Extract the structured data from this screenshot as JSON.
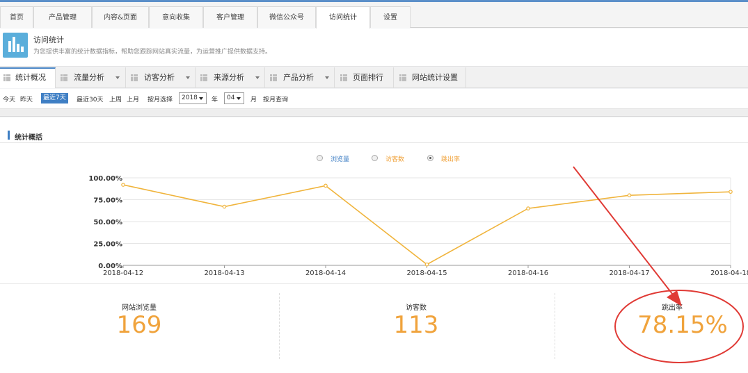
{
  "top_tabs": [
    {
      "label": "首页"
    },
    {
      "label": "产品管理"
    },
    {
      "label": "内容&页面"
    },
    {
      "label": "意向收集"
    },
    {
      "label": "客户管理"
    },
    {
      "label": "微信公众号"
    },
    {
      "label": "访问统计",
      "active": true
    },
    {
      "label": "设置"
    }
  ],
  "header": {
    "title": "访问统计",
    "desc": "为您提供丰富的统计数据指标，帮助您跟踪网站真实流量，为运营推广提供数据支持。",
    "logo_icon": "bar-chart-icon"
  },
  "sub_tabs": [
    {
      "label": "统计概况",
      "active": true
    },
    {
      "label": "流量分析",
      "dropdown": true
    },
    {
      "label": "访客分析",
      "dropdown": true
    },
    {
      "label": "来源分析",
      "dropdown": true
    },
    {
      "label": "产品分析",
      "dropdown": true
    },
    {
      "label": "页面排行"
    },
    {
      "label": "网站统计设置"
    }
  ],
  "filters": {
    "today": "今天",
    "yesterday": "昨天",
    "last7": "最近7天",
    "last30": "最近30天",
    "last_week": "上周",
    "last_month": "上月",
    "by_month": "按月选择",
    "year_value": "2018",
    "year_unit": "年",
    "month_value": "04",
    "month_unit": "月",
    "query": "按月查询"
  },
  "panel_title": "统计概括",
  "legend": [
    {
      "label": "浏览量",
      "color": "#3f7fc4",
      "selected": false
    },
    {
      "label": "访客数",
      "color": "#f0a33c",
      "selected": false
    },
    {
      "label": "跳出率",
      "color": "#f0a33c",
      "selected": true
    }
  ],
  "chart_data": {
    "type": "line",
    "x": [
      "2018-04-12",
      "2018-04-13",
      "2018-04-14",
      "2018-04-15",
      "2018-04-16",
      "2018-04-17",
      "2018-04-18"
    ],
    "series": [
      {
        "name": "跳出率",
        "values": [
          92,
          67,
          91,
          1,
          65,
          80,
          84
        ]
      }
    ],
    "ylim": [
      0,
      100
    ],
    "yticks": [
      "0.00%",
      "25.00%",
      "50.00%",
      "75.00%",
      "100.00%"
    ],
    "line_color": "#f0b43c",
    "grid": true
  },
  "stats": [
    {
      "label": "网站浏览量",
      "value": "169"
    },
    {
      "label": "访客数",
      "value": "113"
    },
    {
      "label": "跳出率",
      "value": "78.15%"
    }
  ],
  "annotation_color": "#e03a35"
}
